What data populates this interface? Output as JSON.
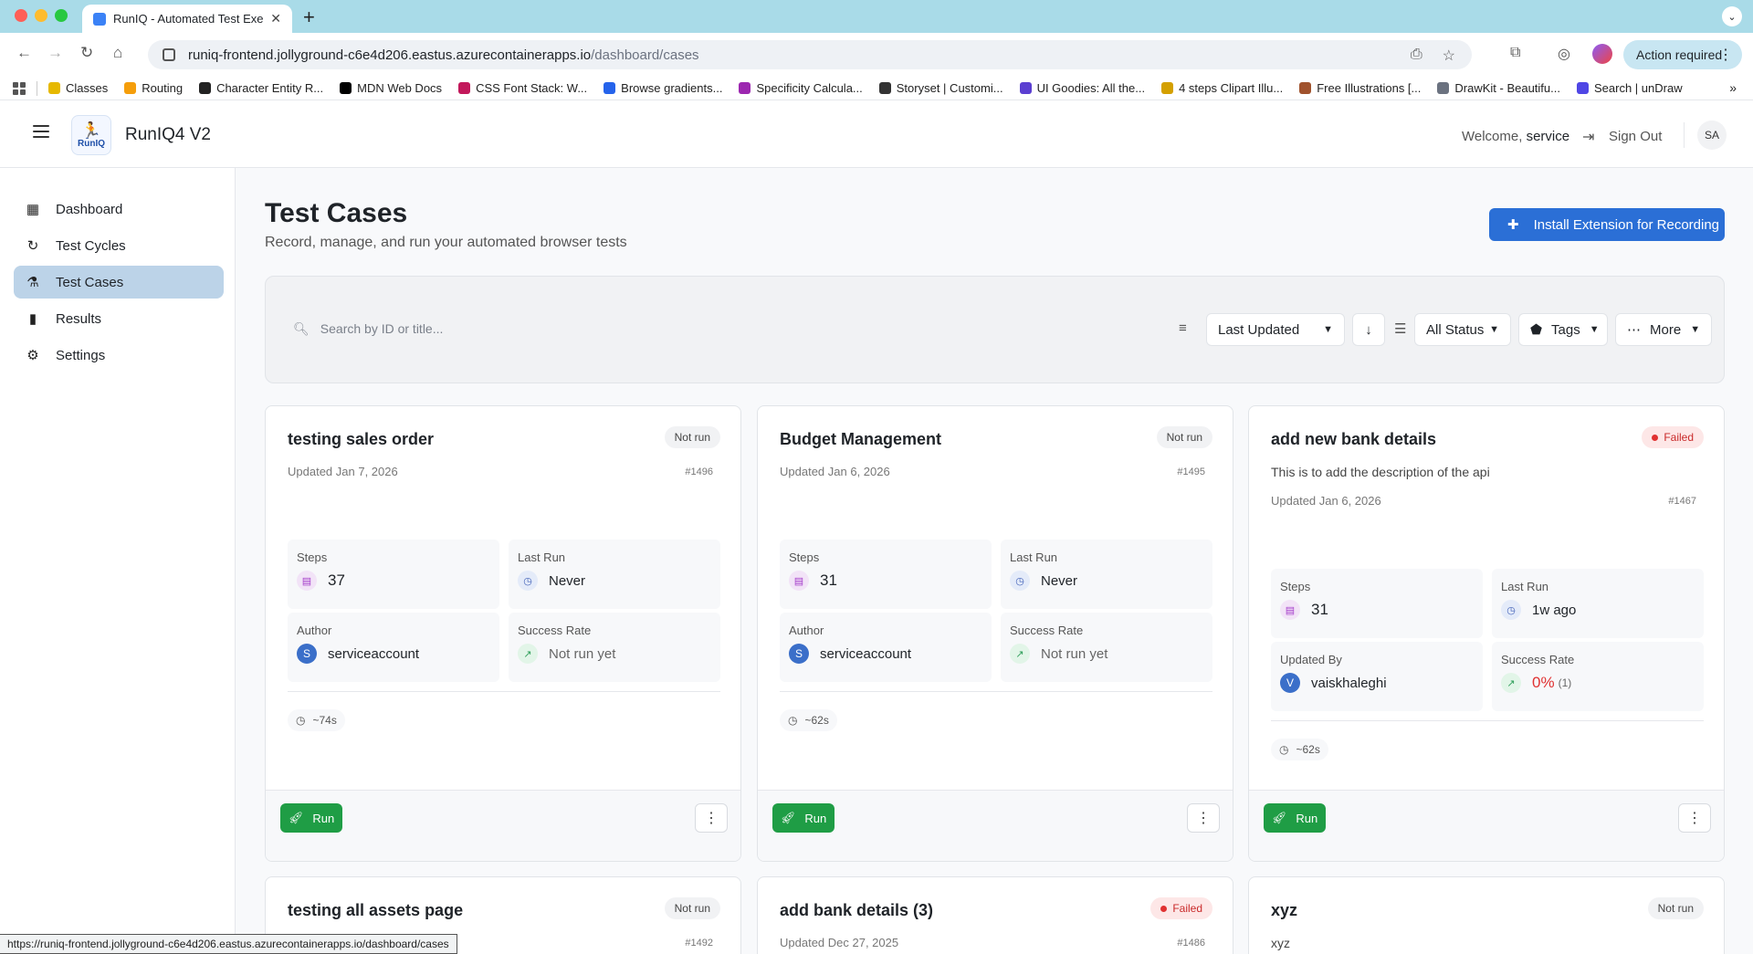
{
  "browser": {
    "tab_title": "RunIQ - Automated Test Exec",
    "url_host": "runiq-frontend.jollyground-c6e4d206.eastus.azurecontainerapps.io",
    "url_path": "/dashboard/cases",
    "action_required": "Action required",
    "status_url": "https://runiq-frontend.jollyground-c6e4d206.eastus.azurecontainerapps.io/dashboard/cases",
    "bookmarks": [
      {
        "label": "Classes",
        "color": "#e6b800"
      },
      {
        "label": "Routing",
        "color": "#f59e0b"
      },
      {
        "label": "Character Entity R...",
        "color": "#222222"
      },
      {
        "label": "MDN Web Docs",
        "color": "#000000"
      },
      {
        "label": "CSS Font Stack: W...",
        "color": "#c2185b"
      },
      {
        "label": "Browse gradients...",
        "color": "#2563eb"
      },
      {
        "label": "Specificity Calcula...",
        "color": "#9c27b0"
      },
      {
        "label": "Storyset | Customi...",
        "color": "#333333"
      },
      {
        "label": "UI Goodies: All the...",
        "color": "#5b3fd1"
      },
      {
        "label": "4 steps Clipart Illu...",
        "color": "#d4a000"
      },
      {
        "label": "Free Illustrations [...",
        "color": "#a0522d"
      },
      {
        "label": "DrawKit - Beautifu...",
        "color": "#6b7280"
      },
      {
        "label": "Search | unDraw",
        "color": "#4f46e5"
      }
    ]
  },
  "header": {
    "logo_text": "RunIQ",
    "app_title": "RunIQ4 V2",
    "welcome_prefix": "Welcome,",
    "username": "service",
    "sign_out": "Sign Out",
    "avatar": "SA"
  },
  "sidebar": {
    "items": [
      {
        "label": "Dashboard",
        "icon": "dashboard-icon"
      },
      {
        "label": "Test Cycles",
        "icon": "refresh-icon"
      },
      {
        "label": "Test Cases",
        "icon": "flask-icon"
      },
      {
        "label": "Results",
        "icon": "bar-chart-icon"
      },
      {
        "label": "Settings",
        "icon": "gear-icon"
      }
    ],
    "active_index": 2
  },
  "page": {
    "title": "Test Cases",
    "subtitle": "Record, manage, and run your automated browser tests",
    "install_button": "Install Extension for Recording"
  },
  "filters": {
    "search_placeholder": "Search by ID or title...",
    "sort_value": "Last Updated",
    "status_value": "All Status",
    "tags_label": "Tags",
    "more_label": "More"
  },
  "labels": {
    "steps": "Steps",
    "last_run": "Last Run",
    "author": "Author",
    "updated_by": "Updated By",
    "success_rate": "Success Rate",
    "run": "Run"
  },
  "cards": [
    {
      "title": "testing sales order",
      "status": "Not run",
      "description": "",
      "updated": "Updated Jan 7, 2026",
      "id": "#1496",
      "steps": "37",
      "last_run": "Never",
      "person_label": "Author",
      "person": "serviceaccount",
      "person_initial": "S",
      "success_rate": "Not run yet",
      "duration": "~74s"
    },
    {
      "title": "Budget Management",
      "status": "Not run",
      "description": "",
      "updated": "Updated Jan 6, 2026",
      "id": "#1495",
      "steps": "31",
      "last_run": "Never",
      "person_label": "Author",
      "person": "serviceaccount",
      "person_initial": "S",
      "success_rate": "Not run yet",
      "duration": "~62s"
    },
    {
      "title": "add new bank details",
      "status": "Failed",
      "description": "This is to add the description of the api",
      "updated": "Updated Jan 6, 2026",
      "id": "#1467",
      "steps": "31",
      "last_run": "1w ago",
      "person_label": "Updated By",
      "person": "vaiskhaleghi",
      "person_initial": "V",
      "success_rate": "0%",
      "success_count": "(1)",
      "duration": "~62s"
    },
    {
      "title": "testing all assets page",
      "status": "Not run",
      "description": "",
      "updated": "",
      "id": "#1492"
    },
    {
      "title": "add bank details (3)",
      "status": "Failed",
      "description": "",
      "updated": "Updated Dec 27, 2025",
      "id": "#1486"
    },
    {
      "title": "xyz",
      "status": "Not run",
      "description": "xyz",
      "updated": "",
      "id": ""
    }
  ]
}
